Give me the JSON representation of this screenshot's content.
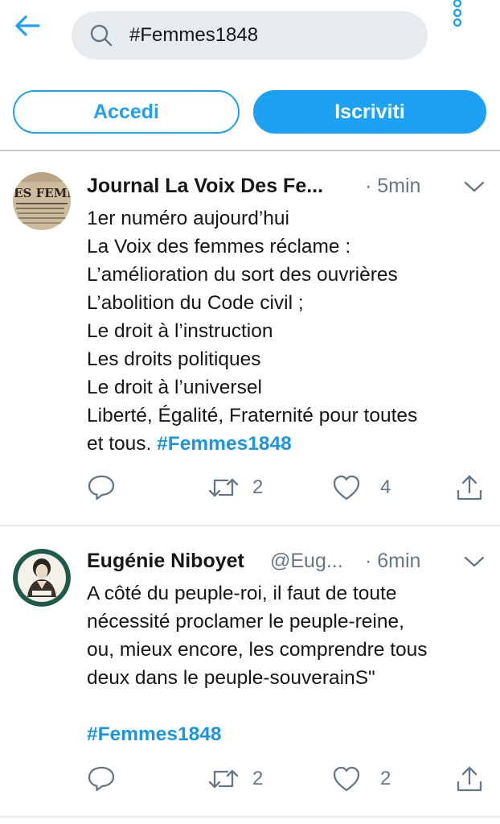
{
  "search": {
    "query": "#Femmes1848"
  },
  "auth": {
    "login_label": "Accedi",
    "signup_label": "Iscriviti"
  },
  "colors": {
    "accent": "#1da1f2",
    "text": "#14171a",
    "muted": "#657786",
    "search_bg": "#e6ecf0"
  },
  "tweets": [
    {
      "display_name": "Journal La Voix Des Fe...",
      "handle": "",
      "time": "· 5min",
      "avatar": "newspaper-masthead-avatar",
      "avatar_text": "DES FEMM",
      "lines": [
        "1er numéro aujourd’hui",
        "La Voix des femmes réclame :",
        "L’amélioration du sort des ouvrières",
        "L’abolition du Code civil ;",
        "Le droit à l’instruction",
        "Les droits politiques",
        "Le droit à l’universel",
        "Liberté, Égalité, Fraternité pour toutes"
      ],
      "last_line": "et tous.",
      "hashtag": "#Femmes1848",
      "retweets": "2",
      "likes": "4"
    },
    {
      "display_name": "Eugénie Niboyet",
      "handle": "@Eug...",
      "time": "· 6min",
      "avatar": "portrait-illustration-avatar",
      "lines": [
        "A côté du peuple-roi, il faut de toute",
        "nécessité proclamer le peuple-reine,",
        "ou, mieux encore, les comprendre tous",
        "deux dans le peuple-souverainS\""
      ],
      "hashtag": "#Femmes1848",
      "retweets": "2",
      "likes": "2"
    }
  ]
}
